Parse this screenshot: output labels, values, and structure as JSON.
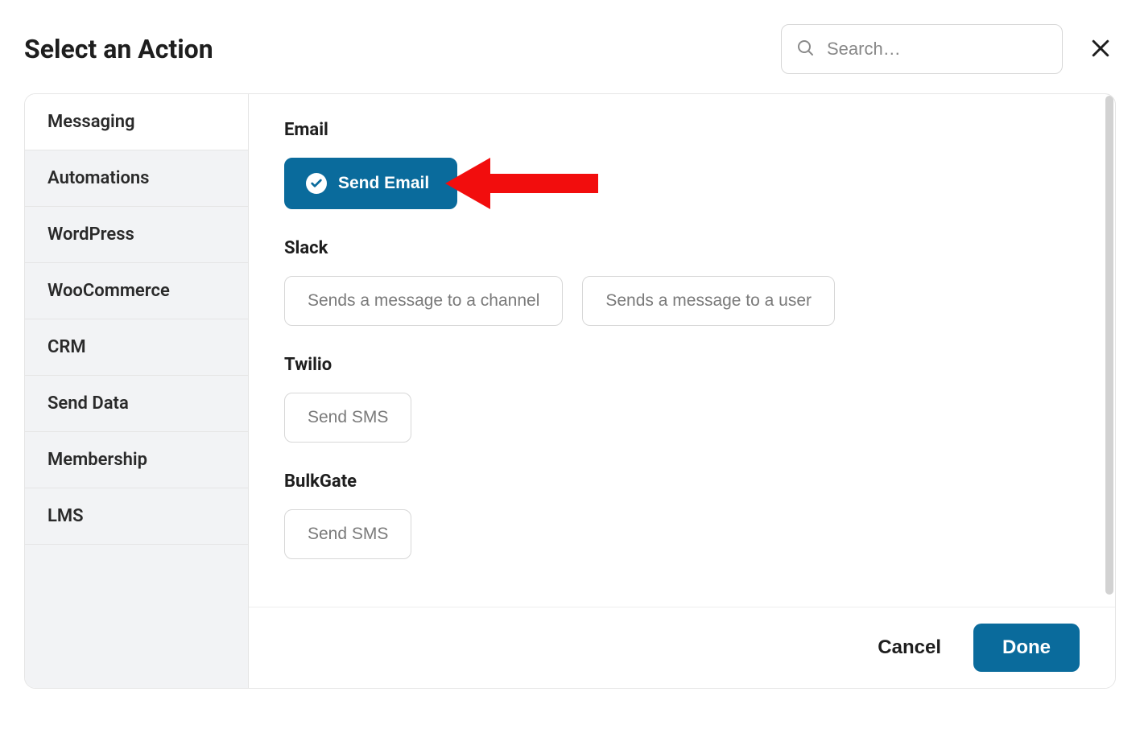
{
  "header": {
    "title": "Select an Action",
    "search_placeholder": "Search…"
  },
  "sidebar": {
    "items": [
      {
        "label": "Messaging",
        "active": true
      },
      {
        "label": "Automations",
        "active": false
      },
      {
        "label": "WordPress",
        "active": false
      },
      {
        "label": "WooCommerce",
        "active": false
      },
      {
        "label": "CRM",
        "active": false
      },
      {
        "label": "Send Data",
        "active": false
      },
      {
        "label": "Membership",
        "active": false
      },
      {
        "label": "LMS",
        "active": false
      }
    ]
  },
  "content": {
    "groups": [
      {
        "title": "Email",
        "actions": [
          {
            "label": "Send Email",
            "selected": true
          }
        ]
      },
      {
        "title": "Slack",
        "actions": [
          {
            "label": "Sends a message to a channel",
            "selected": false
          },
          {
            "label": "Sends a message to a user",
            "selected": false
          }
        ]
      },
      {
        "title": "Twilio",
        "actions": [
          {
            "label": "Send SMS",
            "selected": false
          }
        ]
      },
      {
        "title": "BulkGate",
        "actions": [
          {
            "label": "Send SMS",
            "selected": false
          }
        ]
      }
    ]
  },
  "footer": {
    "cancel_label": "Cancel",
    "done_label": "Done"
  },
  "annotation": {
    "arrow_points_to": "send-email-action"
  }
}
